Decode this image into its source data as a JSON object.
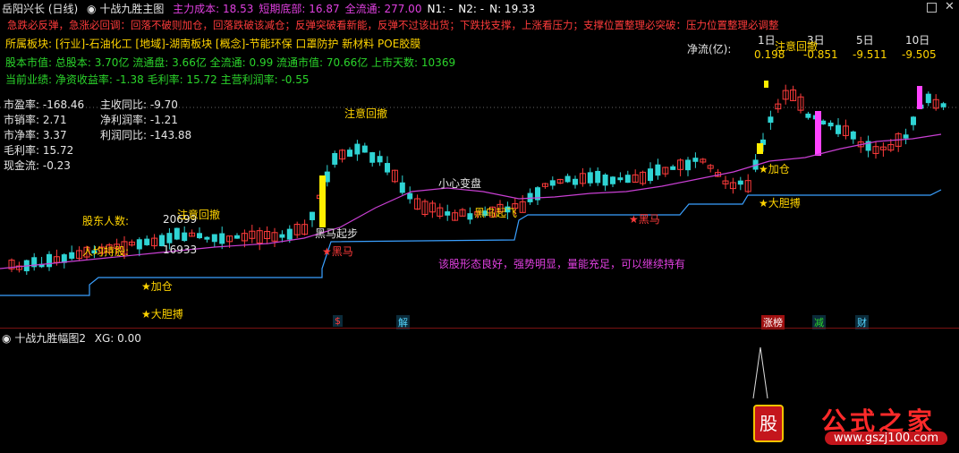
{
  "window": {
    "title": "岳阳兴长 (日线)",
    "indicator_name": "十战九胜主图",
    "close_icon": "close-icon",
    "restore_icon": "restore-icon",
    "menu_icon": "chevron-down-icon"
  },
  "header_values": [
    {
      "label": "主力成本:",
      "value": "18.53",
      "color": "#e040e0"
    },
    {
      "label": "短期底部:",
      "value": "16.87",
      "color": "#e040e0"
    },
    {
      "label": "全流通:",
      "value": "277.00",
      "color": "#e040e0"
    },
    {
      "label": "N1:",
      "value": "-",
      "color": "#ffffff"
    },
    {
      "label": "N2:",
      "value": "-",
      "color": "#ffffff"
    },
    {
      "label": "N:",
      "value": "19.33",
      "color": "#ffffff"
    }
  ],
  "warning_line": "急跌必反弹，急涨必回调：回落不破则加仓，回落跌破该减仓；反弹突破看新能，反弹不过该出货；下跌找支撑，上涨看压力；支撑位置整理必突破：压力位置整理必调整",
  "industry": {
    "label": "所属板块:",
    "text": "[行业]-石油化工 [地域]-湖南板块 [概念]-节能环保 口罩防护 新材料 POE胶膜"
  },
  "capital": "股本市值: 总股本: 3.70亿 流通盘: 3.66亿 全流通: 0.99 流通市值: 70.66亿 上市天数: 10369",
  "performance": "当前业绩: 净资收益率: -1.38 毛利率: 15.72 主营利润率: -0.55",
  "fundamentals_left": [
    {
      "label": "市盈率:",
      "value": "-168.46"
    },
    {
      "label": "市销率:",
      "value": "2.71"
    },
    {
      "label": "市净率:",
      "value": "3.37"
    },
    {
      "label": "毛利率:",
      "value": "15.72"
    },
    {
      "label": "现金流:",
      "value": "-0.23"
    }
  ],
  "fundamentals_right": [
    {
      "label": "主收同比:",
      "value": "-9.70"
    },
    {
      "label": "净利润率:",
      "value": "-1.21"
    },
    {
      "label": "利润同比:",
      "value": "-143.88"
    }
  ],
  "net_flow": {
    "label": "净流(亿):",
    "columns": [
      {
        "period": "1日",
        "value": "0.198"
      },
      {
        "period": "3日",
        "value": "-0.851"
      },
      {
        "period": "5日",
        "value": "-9.511"
      },
      {
        "period": "10日",
        "value": "-9.505"
      }
    ]
  },
  "holders": [
    {
      "label": "股东人数:",
      "value": "20699"
    },
    {
      "label": "人均持股:",
      "value": "16933"
    }
  ],
  "annotations": {
    "attention_pullback": "注意回撤",
    "careful_change": "小心变盘",
    "add_position": "★加仓",
    "bold_fight": "★大胆搏",
    "black_horse": "★黑马",
    "crow_start": "黑乌起飞",
    "black_step": "黑马起步",
    "commentary": "该股形态良好，强势明显，量能充足，可以继续持有"
  },
  "event_badges": [
    {
      "label": "$",
      "color": "#ff3b3b"
    },
    {
      "label": "解",
      "color": "#55d6ff"
    },
    {
      "label": "涨榜",
      "color": "#ffffff"
    },
    {
      "label": "减",
      "color": "#2bd52b"
    },
    {
      "label": "财",
      "color": "#55d6ff"
    }
  ],
  "sub_panel": {
    "title": "十战九胜幅图2",
    "xg_label": "XG:",
    "xg_value": "0.00"
  },
  "watermark": {
    "brand": "公式之家",
    "url": "www.gszj100.com"
  },
  "colors": {
    "up": "#ff3b3b",
    "down": "#2fd4d4",
    "ma_line": "#c93fd3",
    "support_line": "#3aa0ff",
    "signal": "#ffee00"
  }
}
